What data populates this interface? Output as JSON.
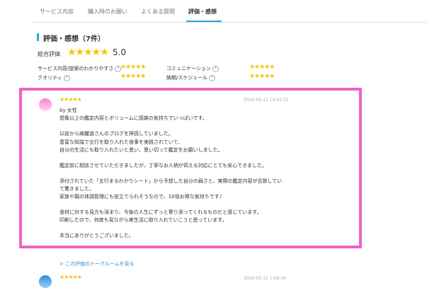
{
  "tabs": [
    "サービス内容",
    "購入時のお願い",
    "よくある質問",
    "評価・感想"
  ],
  "section_title": "評価・感想（7件）",
  "overall": {
    "label": "総合評価",
    "stars": "★★★★★",
    "score": "5.0"
  },
  "sub_ratings": [
    {
      "label": "サービス内容/提案のわかりやすさ",
      "stars": "★★★★★"
    },
    {
      "label": "コミュニケーション",
      "stars": "★★★★★"
    },
    {
      "label": "クオリティ",
      "stars": "★★★★★"
    },
    {
      "label": "納期/スケジュール",
      "stars": "★★★★★"
    }
  ],
  "help_icon_glyph": "?",
  "review": {
    "stars": "★★★★★",
    "date": "2020-05-11 19:43:22",
    "author": "by 女性",
    "lines": [
      "想像以上の鑑定内容とボリュームに感謝の気持ちでいっぱいです。",
      "以前から綺麗道さんのブログを拝読していました。",
      "豊富な知識で五行を取り入れた食事を実践されていて、",
      "自分の生活にも取り入れたいと思い、思い切って鑑定をお願いしました。",
      "鑑定前に相談させていただきましたが、丁寧なお人柄が伺える対応にとても安心できました。",
      "添付されていた「五行まるわかりシート」から予想した自分の弱さと、実際の鑑定内容が合致してい",
      "て驚きました。",
      "家族や親の体調管理にも役立てられそうなので、10倍お得な気持ちです♪",
      "食材に対する見方も深まり、今後の人生にずっと寄り添ってくれるものだと感じています。",
      "印刷したので、何度も見ながら実生活に取り入れていこうと思っています。",
      "本当にありがとうございました。"
    ]
  },
  "more_link": "> この評価のトークルームを見る",
  "review2": {
    "stars": "★★★★★",
    "date": "2020-05-11 1:58:34"
  }
}
